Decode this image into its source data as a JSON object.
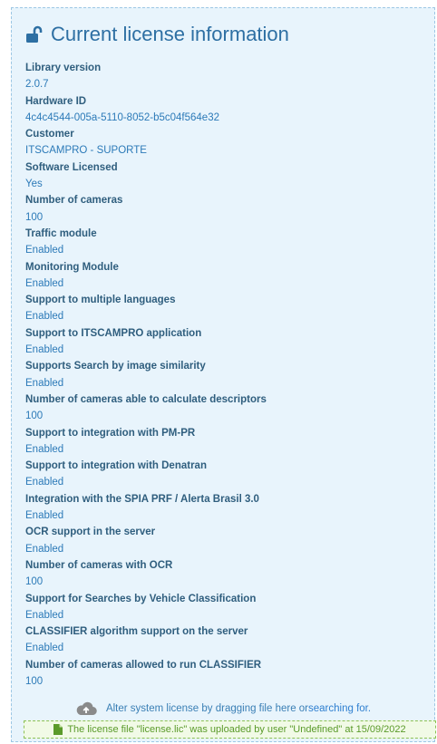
{
  "title": "Current license information",
  "fields": [
    {
      "label": "Library version",
      "value": "2.0.7"
    },
    {
      "label": "Hardware ID",
      "value": "4c4c4544-005a-5110-8052-b5c04f564e32"
    },
    {
      "label": "Customer",
      "value": "ITSCAMPRO - SUPORTE"
    },
    {
      "label": "Software Licensed",
      "value": "Yes"
    },
    {
      "label": "Number of cameras",
      "value": "100"
    },
    {
      "label": "Traffic module",
      "value": "Enabled"
    },
    {
      "label": "Monitoring Module",
      "value": "Enabled"
    },
    {
      "label": "Support to multiple languages",
      "value": "Enabled"
    },
    {
      "label": "Support to ITSCAMPRO application",
      "value": "Enabled"
    },
    {
      "label": "Supports Search by image similarity",
      "value": "Enabled"
    },
    {
      "label": "Number of cameras able to calculate descriptors",
      "value": "100"
    },
    {
      "label": "Support to integration with PM-PR",
      "value": "Enabled"
    },
    {
      "label": "Support to integration with Denatran",
      "value": "Enabled"
    },
    {
      "label": "Integration with the SPIA PRF / Alerta Brasil 3.0",
      "value": "Enabled"
    },
    {
      "label": "OCR support in the server",
      "value": "Enabled"
    },
    {
      "label": "Number of cameras with OCR",
      "value": "100"
    },
    {
      "label": "Support for Searches by Vehicle Classification",
      "value": "Enabled"
    },
    {
      "label": "CLASSIFIER algorithm support on the server",
      "value": "Enabled"
    },
    {
      "label": "Number of cameras allowed to run CLASSIFIER",
      "value": "100"
    }
  ],
  "upload": {
    "text": "Alter system license by dragging file here or",
    "link": "searching for.",
    "icon": "cloud-upload-icon"
  },
  "notice": {
    "text": "The license file \"license.lic\" was uploaded by user \"Undefined\" at 15/09/2022",
    "icon": "file-icon"
  },
  "title_icon": "unlock-icon"
}
